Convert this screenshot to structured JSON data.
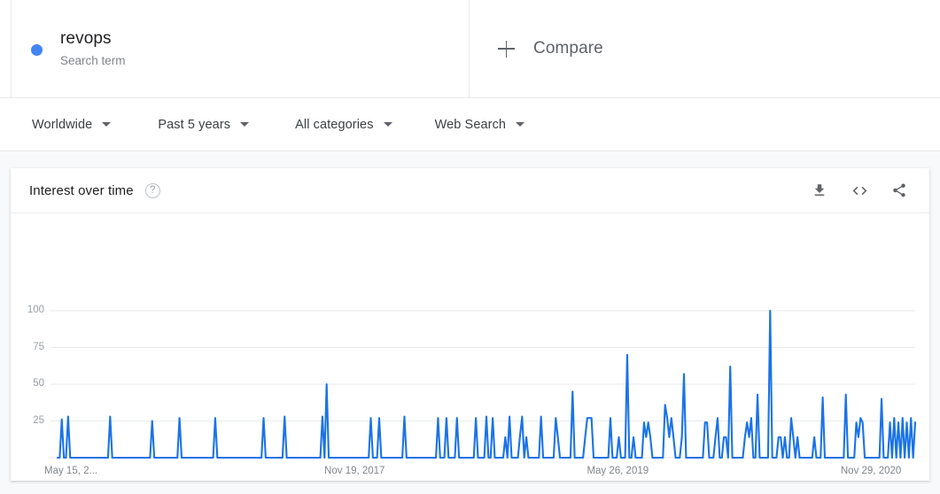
{
  "term_card": {
    "name": "revops",
    "subtitle": "Search term",
    "dot_color": "#4285f4"
  },
  "compare": {
    "label": "Compare",
    "icon": "plus-icon"
  },
  "filters": [
    {
      "label": "Worldwide",
      "icon": "chevron-down-icon"
    },
    {
      "label": "Past 5 years",
      "icon": "chevron-down-icon"
    },
    {
      "label": "All categories",
      "icon": "chevron-down-icon"
    },
    {
      "label": "Web Search",
      "icon": "chevron-down-icon"
    }
  ],
  "chart_card": {
    "title": "Interest over time",
    "help_icon": "?",
    "actions": [
      {
        "name": "download-icon",
        "tooltip": "Download"
      },
      {
        "name": "embed-code-icon",
        "tooltip": "Embed"
      },
      {
        "name": "share-icon",
        "tooltip": "Share"
      }
    ]
  },
  "chart_data": {
    "type": "line",
    "title": "Interest over time",
    "xlabel": "",
    "ylabel": "",
    "ylim": [
      0,
      100
    ],
    "yticks": [
      25,
      50,
      75,
      100
    ],
    "grid": true,
    "legend_position": "top",
    "line_color": "#1a73e8",
    "xtick_labels": [
      "May 15, 2...",
      "Nov 19, 2017",
      "May 26, 2019",
      "Nov 29, 2020"
    ],
    "xtick_positions": [
      0,
      0.3265,
      0.6327,
      0.9286
    ],
    "series": [
      {
        "name": "revops",
        "values": [
          0,
          0,
          26,
          0,
          0,
          28,
          0,
          0,
          0,
          0,
          0,
          0,
          0,
          0,
          0,
          0,
          0,
          0,
          0,
          0,
          0,
          0,
          0,
          0,
          0,
          28,
          0,
          0,
          0,
          0,
          0,
          0,
          0,
          0,
          0,
          0,
          0,
          0,
          0,
          0,
          0,
          0,
          0,
          0,
          0,
          25,
          0,
          0,
          0,
          0,
          0,
          0,
          0,
          0,
          0,
          0,
          0,
          0,
          27,
          0,
          0,
          0,
          0,
          0,
          0,
          0,
          0,
          0,
          0,
          0,
          0,
          0,
          0,
          0,
          0,
          27,
          0,
          0,
          0,
          0,
          0,
          0,
          0,
          0,
          0,
          0,
          0,
          0,
          0,
          0,
          0,
          0,
          0,
          0,
          0,
          0,
          0,
          0,
          27,
          0,
          0,
          0,
          0,
          0,
          0,
          0,
          0,
          0,
          28,
          0,
          0,
          0,
          0,
          0,
          0,
          0,
          0,
          0,
          0,
          0,
          0,
          0,
          0,
          0,
          0,
          0,
          28,
          0,
          50,
          0,
          0,
          0,
          0,
          0,
          0,
          0,
          0,
          0,
          0,
          0,
          0,
          0,
          0,
          0,
          0,
          0,
          0,
          0,
          0,
          27,
          0,
          0,
          0,
          27,
          0,
          0,
          0,
          0,
          0,
          0,
          0,
          0,
          0,
          0,
          0,
          28,
          0,
          0,
          0,
          0,
          0,
          0,
          0,
          0,
          0,
          0,
          0,
          0,
          0,
          0,
          0,
          27,
          0,
          0,
          0,
          27,
          0,
          0,
          0,
          0,
          27,
          0,
          0,
          0,
          0,
          0,
          0,
          0,
          0,
          27,
          0,
          0,
          0,
          0,
          28,
          0,
          0,
          27,
          0,
          0,
          0,
          0,
          0,
          14,
          0,
          28,
          0,
          0,
          0,
          0,
          15,
          28,
          0,
          14,
          0,
          0,
          0,
          0,
          0,
          0,
          28,
          0,
          0,
          0,
          0,
          0,
          0,
          27,
          14,
          0,
          0,
          0,
          0,
          0,
          0,
          45,
          0,
          0,
          0,
          0,
          0,
          14,
          27,
          27,
          27,
          0,
          0,
          0,
          0,
          0,
          0,
          0,
          0,
          27,
          0,
          0,
          0,
          14,
          0,
          0,
          0,
          70,
          0,
          0,
          14,
          0,
          0,
          0,
          0,
          24,
          14,
          24,
          14,
          0,
          0,
          0,
          0,
          0,
          0,
          36,
          27,
          14,
          27,
          14,
          0,
          0,
          0,
          14,
          57,
          0,
          0,
          0,
          0,
          0,
          0,
          0,
          0,
          0,
          24,
          24,
          0,
          0,
          0,
          14,
          27,
          0,
          0,
          14,
          14,
          0,
          62,
          0,
          0,
          0,
          0,
          0,
          0,
          14,
          24,
          14,
          27,
          0,
          0,
          43,
          0,
          0,
          0,
          0,
          0,
          100,
          0,
          0,
          0,
          14,
          14,
          0,
          14,
          0,
          0,
          27,
          14,
          0,
          14,
          0,
          0,
          0,
          0,
          0,
          0,
          0,
          14,
          0,
          0,
          0,
          41,
          0,
          0,
          0,
          0,
          0,
          0,
          0,
          0,
          0,
          0,
          43,
          0,
          0,
          0,
          0,
          24,
          14,
          27,
          24,
          0,
          0,
          0,
          0,
          0,
          0,
          0,
          0,
          40,
          0,
          0,
          0,
          24,
          0,
          27,
          0,
          24,
          0,
          27,
          0,
          24,
          0,
          27,
          0,
          24
        ]
      }
    ]
  }
}
